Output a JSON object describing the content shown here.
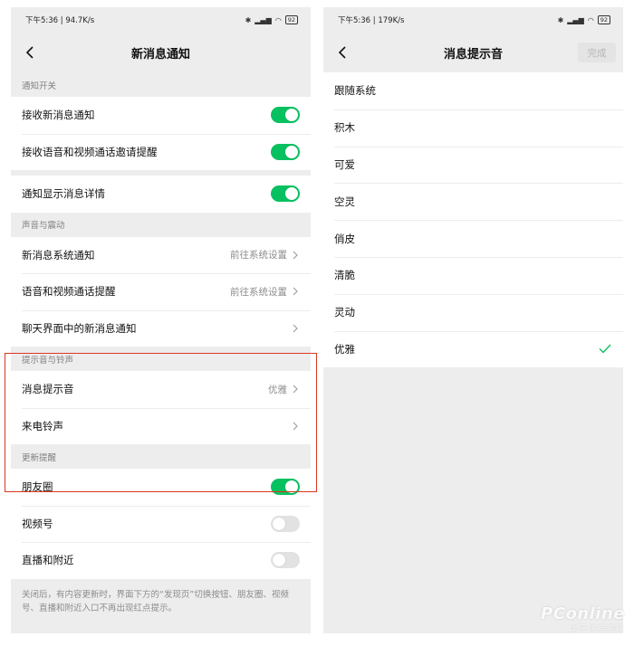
{
  "left": {
    "status": {
      "time": "下午5:36 | 94.7K/s",
      "battery": "92"
    },
    "title": "新消息通知",
    "sections": {
      "notify_switch": {
        "header": "通知开关",
        "items": [
          {
            "label": "接收新消息通知",
            "on": true
          },
          {
            "label": "接收语音和视频通话邀请提醒",
            "on": true
          }
        ],
        "detail": {
          "label": "通知显示消息详情",
          "on": true
        }
      },
      "sound_vibration": {
        "header": "声音与震动",
        "items": [
          {
            "label": "新消息系统通知",
            "value": "前往系统设置"
          },
          {
            "label": "语音和视频通话提醒",
            "value": "前往系统设置"
          },
          {
            "label": "聊天界面中的新消息通知",
            "value": ""
          }
        ]
      },
      "tones": {
        "header": "提示音与铃声",
        "items": [
          {
            "label": "消息提示音",
            "value": "优雅"
          },
          {
            "label": "来电铃声",
            "value": ""
          }
        ]
      },
      "updates": {
        "header": "更新提醒",
        "items": [
          {
            "label": "朋友圈",
            "on": true
          },
          {
            "label": "视频号",
            "on": false
          },
          {
            "label": "直播和附近",
            "on": false
          }
        ],
        "footnote": "关闭后，有内容更新时，界面下方的“发现页”切换按钮、朋友圈、视频号、直播和附近入口不再出现红点提示。"
      }
    }
  },
  "right": {
    "status": {
      "time": "下午5:36 | 179K/s",
      "battery": "92"
    },
    "title": "消息提示音",
    "done_label": "完成",
    "sounds": [
      {
        "label": "跟随系统",
        "selected": false
      },
      {
        "label": "积木",
        "selected": false
      },
      {
        "label": "可爱",
        "selected": false
      },
      {
        "label": "空灵",
        "selected": false
      },
      {
        "label": "俏皮",
        "selected": false
      },
      {
        "label": "清脆",
        "selected": false
      },
      {
        "label": "灵动",
        "selected": false
      },
      {
        "label": "优雅",
        "selected": true
      }
    ]
  },
  "watermark": {
    "main": "PConline",
    "sub": "太平洋电脑网"
  },
  "colors": {
    "accent": "#07c160",
    "highlight": "#d9371f",
    "background": "#ededed"
  }
}
